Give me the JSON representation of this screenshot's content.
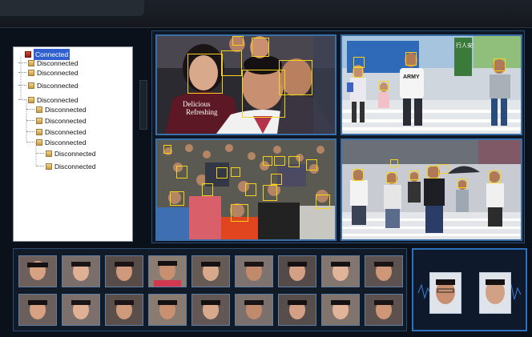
{
  "tree": {
    "root_label": "Connected",
    "items": [
      {
        "label": "Disconnected",
        "level": 1
      },
      {
        "label": "Disconnected",
        "level": 1
      },
      {
        "label": "Disconnected",
        "level": 1
      },
      {
        "label": "Disconnected",
        "level": 1
      },
      {
        "label": "Disconnected",
        "level": 2
      },
      {
        "label": "Disconnected",
        "level": 2
      },
      {
        "label": "Disconnected",
        "level": 2
      },
      {
        "label": "Disconnected",
        "level": 2
      },
      {
        "label": "Disconnected",
        "level": 3
      },
      {
        "label": "Disconnected",
        "level": 3
      }
    ]
  },
  "video": {
    "tile1_shirt_text_line1": "Delicious",
    "tile1_shirt_text_line2": "Refreshing",
    "tile2_shirt_text": "ARMY",
    "tile2_sign_text": "行人安全通道"
  },
  "colors": {
    "face_box": "#f5d21c",
    "tile_border": "#3b6fa8",
    "selected_bg": "#2f5fd0",
    "match_border": "#2f6fc0"
  },
  "icons": {
    "root_node": "camera-node-icon",
    "child_node": "folder-node-icon"
  }
}
